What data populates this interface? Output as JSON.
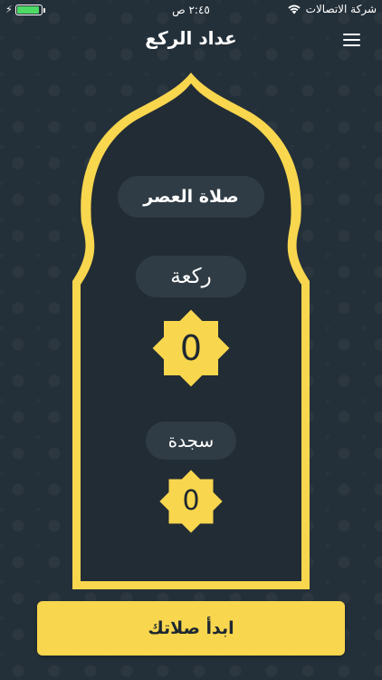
{
  "status_bar": {
    "carrier": "شركة الاتصالات",
    "time": "٢:٤٥ ص",
    "battery_level": 0.95
  },
  "nav": {
    "title": "عداد الركع",
    "menu_icon": "hamburger-menu-icon"
  },
  "prayer": {
    "name": "صلاة العصر"
  },
  "rakah": {
    "label": "ركعة",
    "count": "0"
  },
  "sajda": {
    "label": "سجدة",
    "count": "0"
  },
  "actions": {
    "start_label": "ابدأ صلاتك"
  },
  "colors": {
    "background": "#243039",
    "accent": "#f8d64e",
    "pill": "#2f3c45",
    "panel": "#222c34"
  }
}
